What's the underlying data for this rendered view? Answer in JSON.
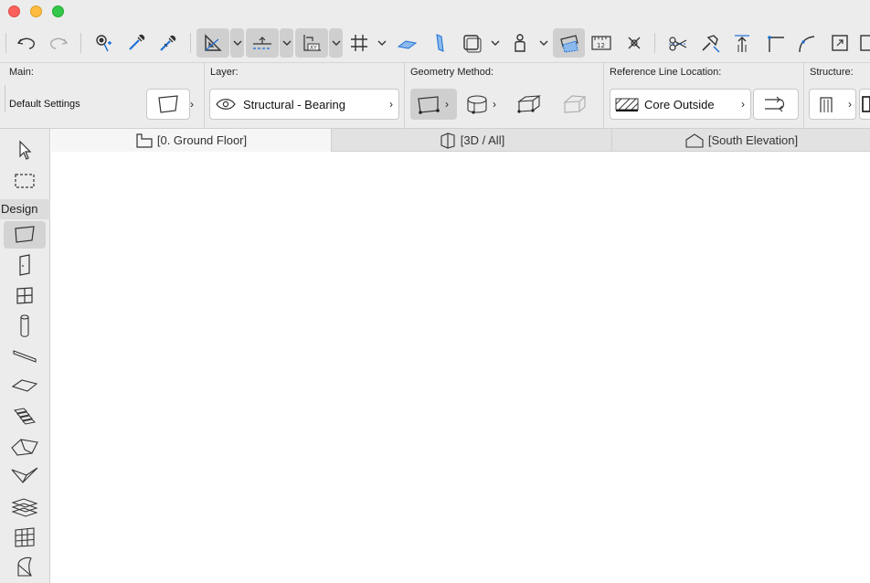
{
  "window": {
    "controls": [
      "close",
      "minimize",
      "zoom"
    ]
  },
  "toolbar": {
    "icons": [
      "undo-icon",
      "redo-icon",
      "find-select-icon",
      "eyedropper-icon",
      "syringe-icon",
      "ruler-angle-icon",
      "guideline-icon",
      "xy-coordinate-icon",
      "grid-snap-icon",
      "plane-icon",
      "wall-shape-icon",
      "view-frame-icon",
      "figure-icon",
      "trace-icon",
      "dimension-icon",
      "spot-icon",
      "split-icon",
      "adjust-icon",
      "offset-icon",
      "corner-icon",
      "curve-icon",
      "resize-icon"
    ],
    "dimension_label": "12"
  },
  "infobox": {
    "main": {
      "label": "Main:",
      "settings_text": "Default Settings"
    },
    "layer": {
      "label": "Layer:",
      "value": "Structural - Bearing"
    },
    "geometry": {
      "label": "Geometry Method:"
    },
    "reference_line": {
      "label": "Reference Line Location:",
      "value": "Core Outside"
    },
    "structure": {
      "label": "Structure:"
    }
  },
  "toolbox": {
    "section_label": "Design"
  },
  "tabs": [
    {
      "label": "[0. Ground Floor]",
      "icon": "floor-plan-icon",
      "active": true
    },
    {
      "label": "[3D / All]",
      "icon": "3d-view-icon",
      "active": false
    },
    {
      "label": "[South Elevation]",
      "icon": "elevation-icon",
      "active": false
    }
  ]
}
